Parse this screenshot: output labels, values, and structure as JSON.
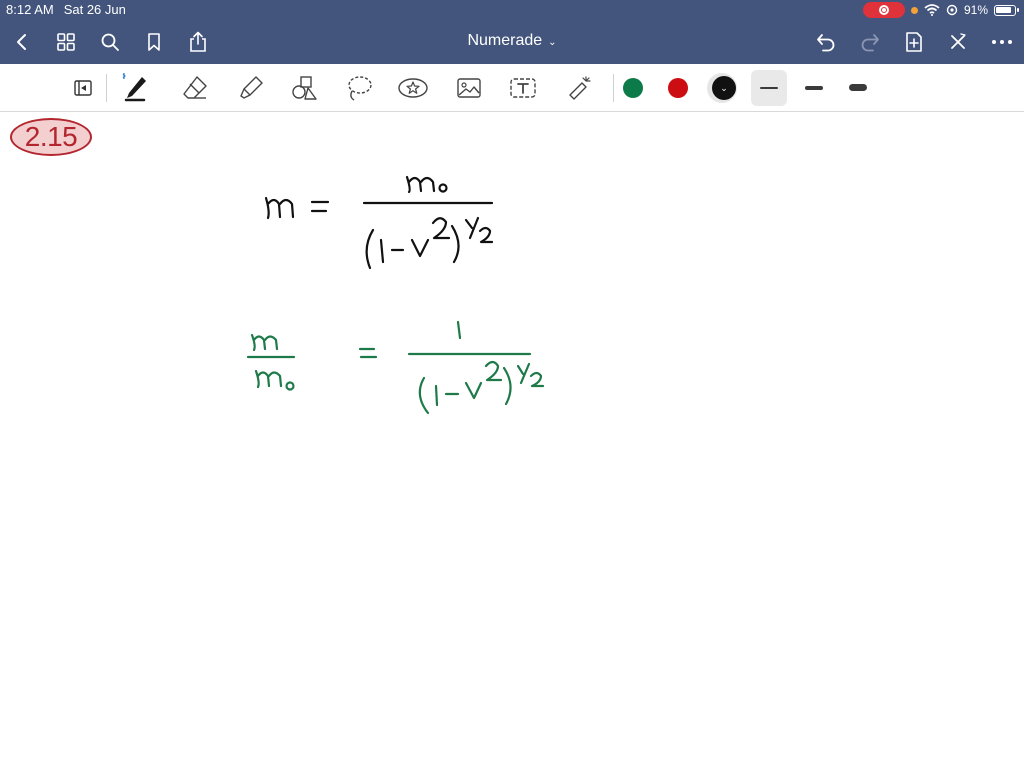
{
  "status_bar": {
    "time": "8:12 AM",
    "date": "Sat 26 Jun",
    "battery_text": "91%",
    "battery_level": 0.91
  },
  "nav": {
    "title": "Numerade",
    "icons": [
      "back-icon",
      "grid-icon",
      "search-icon",
      "bookmark-icon",
      "share-icon",
      "undo-icon",
      "redo-icon",
      "add-page-icon",
      "close-icon",
      "more-icon"
    ]
  },
  "toolbar": {
    "tools": [
      "read-mode-icon",
      "pen-icon",
      "eraser-icon",
      "highlighter-icon",
      "shapes-icon",
      "lasso-icon",
      "sticker-icon",
      "image-icon",
      "text-icon",
      "laser-pointer-icon"
    ],
    "colors": [
      "#0d7a4a",
      "#cc0d12",
      "#111111"
    ],
    "selected_color": "#111111",
    "stroke_widths": [
      "thin",
      "medium",
      "thick"
    ],
    "selected_stroke": "thin"
  },
  "canvas": {
    "problem_label": "2.15",
    "ink_colors": {
      "black": "#111111",
      "green": "#1f7a4a",
      "red": "#b3262e"
    }
  }
}
